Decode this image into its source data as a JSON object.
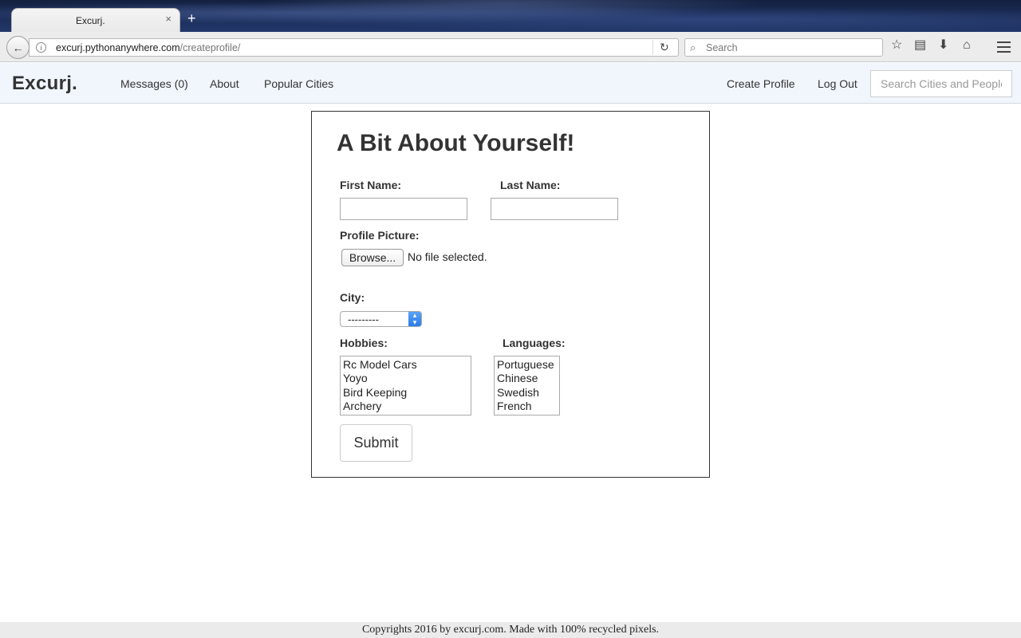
{
  "browser": {
    "tab_title": "Excurj.",
    "tab_close": "×",
    "new_tab": "+",
    "url_host": "excurj.pythonanywhere.com",
    "url_path": "/createprofile/",
    "search_placeholder": "Search"
  },
  "site": {
    "brand": "Excurj.",
    "nav": {
      "messages": "Messages (0)",
      "about": "About",
      "popular_cities": "Popular Cities",
      "create_profile": "Create Profile",
      "log_out": "Log Out"
    },
    "search_placeholder": "Search Cities and People"
  },
  "form": {
    "title": "A Bit About Yourself!",
    "first_name_label": "First Name:",
    "last_name_label": "Last Name:",
    "profile_picture_label": "Profile Picture:",
    "browse_button": "Browse...",
    "file_status": "No file selected.",
    "city_label": "City:",
    "city_selected": "---------",
    "hobbies_label": "Hobbies:",
    "hobbies": [
      "Rc Model Cars",
      "Yoyo",
      "Bird Keeping",
      "Archery"
    ],
    "languages_label": "Languages:",
    "languages": [
      "Portuguese",
      "Chinese",
      "Swedish",
      "French"
    ],
    "submit_label": "Submit"
  },
  "footer": {
    "text": "Copyrights 2016 by excurj.com. Made with 100% recycled pixels."
  }
}
